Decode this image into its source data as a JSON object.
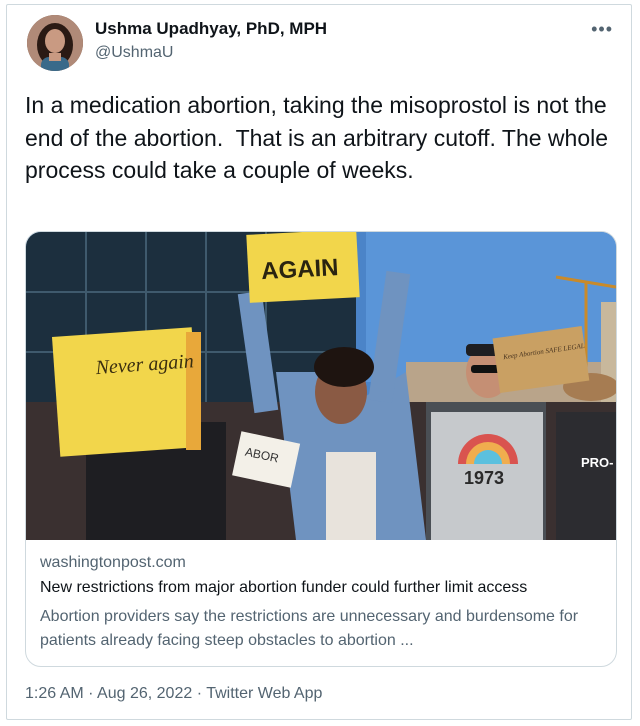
{
  "author": {
    "name": "Ushma Upadhyay, PhD, MPH",
    "handle": "@UshmaU"
  },
  "more_label": "•••",
  "tweet_text": "In a medication abortion, taking the misoprostol is not the end of the abortion.  That is an arbitrary cutoff. The whole process could take a couple of weeks.",
  "card": {
    "domain": "washingtonpost.com",
    "title": "New restrictions from major abortion funder could further limit access",
    "description": "Abortion providers say the restrictions are unnecessary and burdensome for patients already facing steep obstacles to abortion ...",
    "image_signs": {
      "left": "Never again",
      "top": "AGAIN",
      "small": "ABOR",
      "right": "PRO-",
      "shirt": "1973",
      "far_right": "Keep Abortion SAFE LEGAL"
    }
  },
  "meta": {
    "time": "1:26 AM",
    "date": "Aug 26, 2022",
    "source": "Twitter Web App",
    "separator": "·"
  }
}
